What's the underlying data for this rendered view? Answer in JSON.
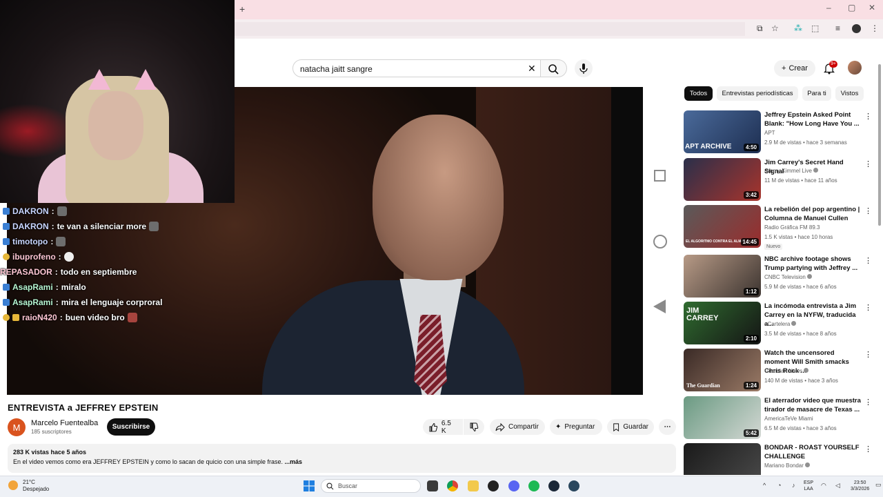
{
  "browser": {
    "new_tab": "+",
    "win_min": "–",
    "win_max": "▢",
    "win_close": "✕"
  },
  "youtube": {
    "search_query": "natacha jaitt sangre",
    "create_label": "Crear",
    "notifications": "9+"
  },
  "video": {
    "title": "ENTREVISTA a JEFFREY EPSTEIN",
    "channel": "Marcelo Fuentealba",
    "channel_initial": "M",
    "subscribers": "185 suscriptores",
    "subscribe_label": "Suscribirse",
    "likes": "6.5 K",
    "share_label": "Compartir",
    "ask_label": "Preguntar",
    "save_label": "Guardar",
    "description_meta": "283 K vistas  hace 5 años",
    "description_text": "En el video vemos como era JEFFREY EPSTEIN y como lo sacan de quicio con una simple frase.",
    "more_label": "...más"
  },
  "chat": [
    {
      "user": "DAKRON",
      "message": ""
    },
    {
      "user": "DAKRON",
      "message": "te van a silenciar more"
    },
    {
      "user": "timotopo",
      "message": ""
    },
    {
      "user": "ibuprofeno",
      "message": ""
    },
    {
      "user": "REPASADOR",
      "message": "todo en septiembre"
    },
    {
      "user": "AsapRami",
      "message": "miralo"
    },
    {
      "user": "AsapRami",
      "message": "mira el lenguaje corproral"
    },
    {
      "user": "raioN420",
      "message": "buen video bro"
    }
  ],
  "chips": [
    "Todos",
    "Entrevistas periodísticas",
    "Para ti",
    "Vistos"
  ],
  "recommendations": [
    {
      "title": "Jeffrey Epstein Asked Point Blank: \"How Long Have You ...",
      "channel": "APT",
      "meta": "2.9 M de vistas • hace 3 semanas",
      "duration": "4:50",
      "thumb_text": "APT ARCHIVE",
      "badge": ""
    },
    {
      "title": "Jim Carrey's Secret Hand Signal",
      "channel": "Jimmy Kimmel Live",
      "meta": "11 M de vistas • hace 11 años",
      "duration": "3:42",
      "thumb_text": "",
      "badge": ""
    },
    {
      "title": "La rebelión del pop argentino | Columna de Manuel Cullen",
      "channel": "Radio Gráfica FM 89.3",
      "meta": "1.5 K vistas • hace 10 horas",
      "duration": "14:45",
      "thumb_text": "EL ALGORITMO CONTRA EL ALMA",
      "badge": "Nuevo"
    },
    {
      "title": "NBC archive footage shows Trump partying with Jeffrey ...",
      "channel": "CNBC Television",
      "meta": "5.9 M de vistas • hace 6 años",
      "duration": "1:12",
      "thumb_text": "",
      "badge": ""
    },
    {
      "title": "La incómoda entrevista a Jim Carrey en la NYFW, traducida a...",
      "channel": "eCartelera",
      "meta": "3.5 M de vistas • hace 8 años",
      "duration": "2:10",
      "thumb_text": "JIM CARREY",
      "badge": ""
    },
    {
      "title": "Watch the uncensored moment Will Smith smacks Chris Rock ...",
      "channel": "Guardian News",
      "meta": "140 M de vistas • hace 3 años",
      "duration": "1:24",
      "thumb_text": "The Guardian",
      "badge": ""
    },
    {
      "title": "El aterrador video que muestra tirador de masacre de Texas ...",
      "channel": "AmericaTeVe Miami",
      "meta": "6.5 M de vistas • hace 3 años",
      "duration": "5:42",
      "thumb_text": "",
      "badge": ""
    },
    {
      "title": "BONDAR - ROAST YOURSELF CHALLENGE",
      "channel": "Mariano Bondar",
      "meta": "",
      "duration": "",
      "thumb_text": "",
      "badge": ""
    }
  ],
  "taskbar": {
    "temperature": "21°C",
    "weather": "Despejado",
    "search_placeholder": "Buscar",
    "lang_top": "ESP",
    "lang_bottom": "LAA",
    "time": "23:50",
    "date": "3/3/2026"
  },
  "colors": {
    "tab_strip": "#f9dfe4",
    "youtube_red": "#cc0000",
    "subscribe_bg": "#0f0f0f",
    "chip_active": "#0f0f0f"
  }
}
